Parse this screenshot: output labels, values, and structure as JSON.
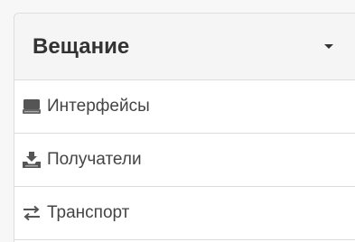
{
  "panel": {
    "title": "Вещание",
    "items": [
      {
        "label": "Интерфейсы",
        "icon": "drive-icon"
      },
      {
        "label": "Получатели",
        "icon": "inbox-download-icon"
      },
      {
        "label": "Транспорт",
        "icon": "transfer-arrows-icon"
      }
    ]
  },
  "colors": {
    "header_bg": "#f5f5f5",
    "border": "#dddddd",
    "text": "#444444"
  }
}
